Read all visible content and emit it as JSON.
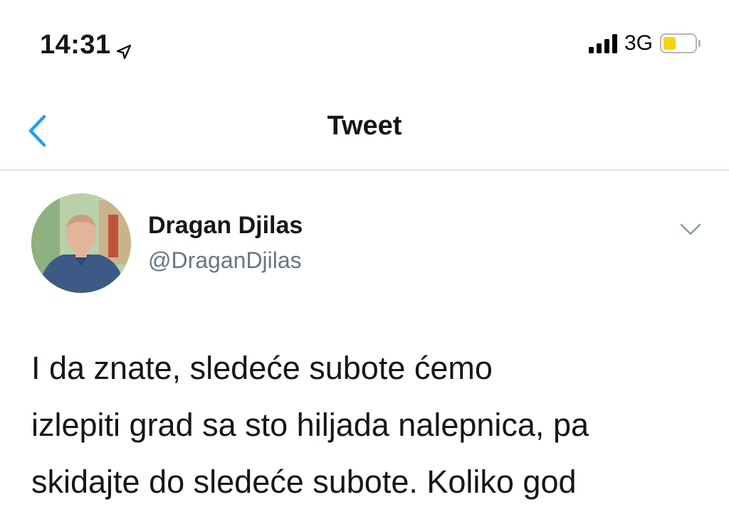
{
  "status_bar": {
    "time": "14:31",
    "location_icon": "location-arrow-icon",
    "signal_icon": "cellular-signal-icon",
    "network": "3G",
    "battery_icon": "battery-icon",
    "battery_level": 0.4,
    "battery_color": "#f6d314"
  },
  "nav": {
    "back_icon": "chevron-left-icon",
    "title": "Tweet",
    "accent_color": "#1da1f2"
  },
  "tweet": {
    "author_name": "Dragan Djilas",
    "author_handle": "@DraganDjilas",
    "avatar_icon": "avatar",
    "menu_icon": "chevron-down-icon",
    "text_lines": [
      "I da znate, sledeće subote ćemo",
      "izlepiti grad sa sto hiljada nalepnica, pa",
      "skidajte do sledeće subote. Koliko god"
    ]
  }
}
